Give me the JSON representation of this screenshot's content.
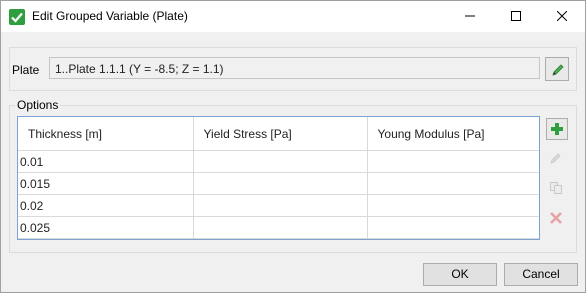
{
  "window": {
    "title": "Edit Grouped Variable (Plate)"
  },
  "plate": {
    "label": "Plate",
    "value": "1..Plate 1.1.1 (Y = -8.5; Z = 1.1)"
  },
  "options": {
    "group_label": "Options",
    "columns": [
      "Thickness [m]",
      "Yield Stress [Pa]",
      "Young Modulus [Pa]"
    ],
    "rows": [
      [
        "0.01",
        "",
        ""
      ],
      [
        "0.015",
        "",
        ""
      ],
      [
        "0.02",
        "",
        ""
      ],
      [
        "0.025",
        "",
        ""
      ]
    ]
  },
  "buttons": {
    "ok": "OK",
    "cancel": "Cancel"
  },
  "icons": {
    "app": "checkmark-icon",
    "edit_plate": "pencil-icon",
    "add": "plus-icon",
    "edit": "pencil-icon",
    "copy": "copy-icon",
    "delete": "delete-icon"
  },
  "colors": {
    "accent_green": "#2e9e3e",
    "grid_border": "#7aa3d4",
    "delete_red": "#e28a8a"
  }
}
